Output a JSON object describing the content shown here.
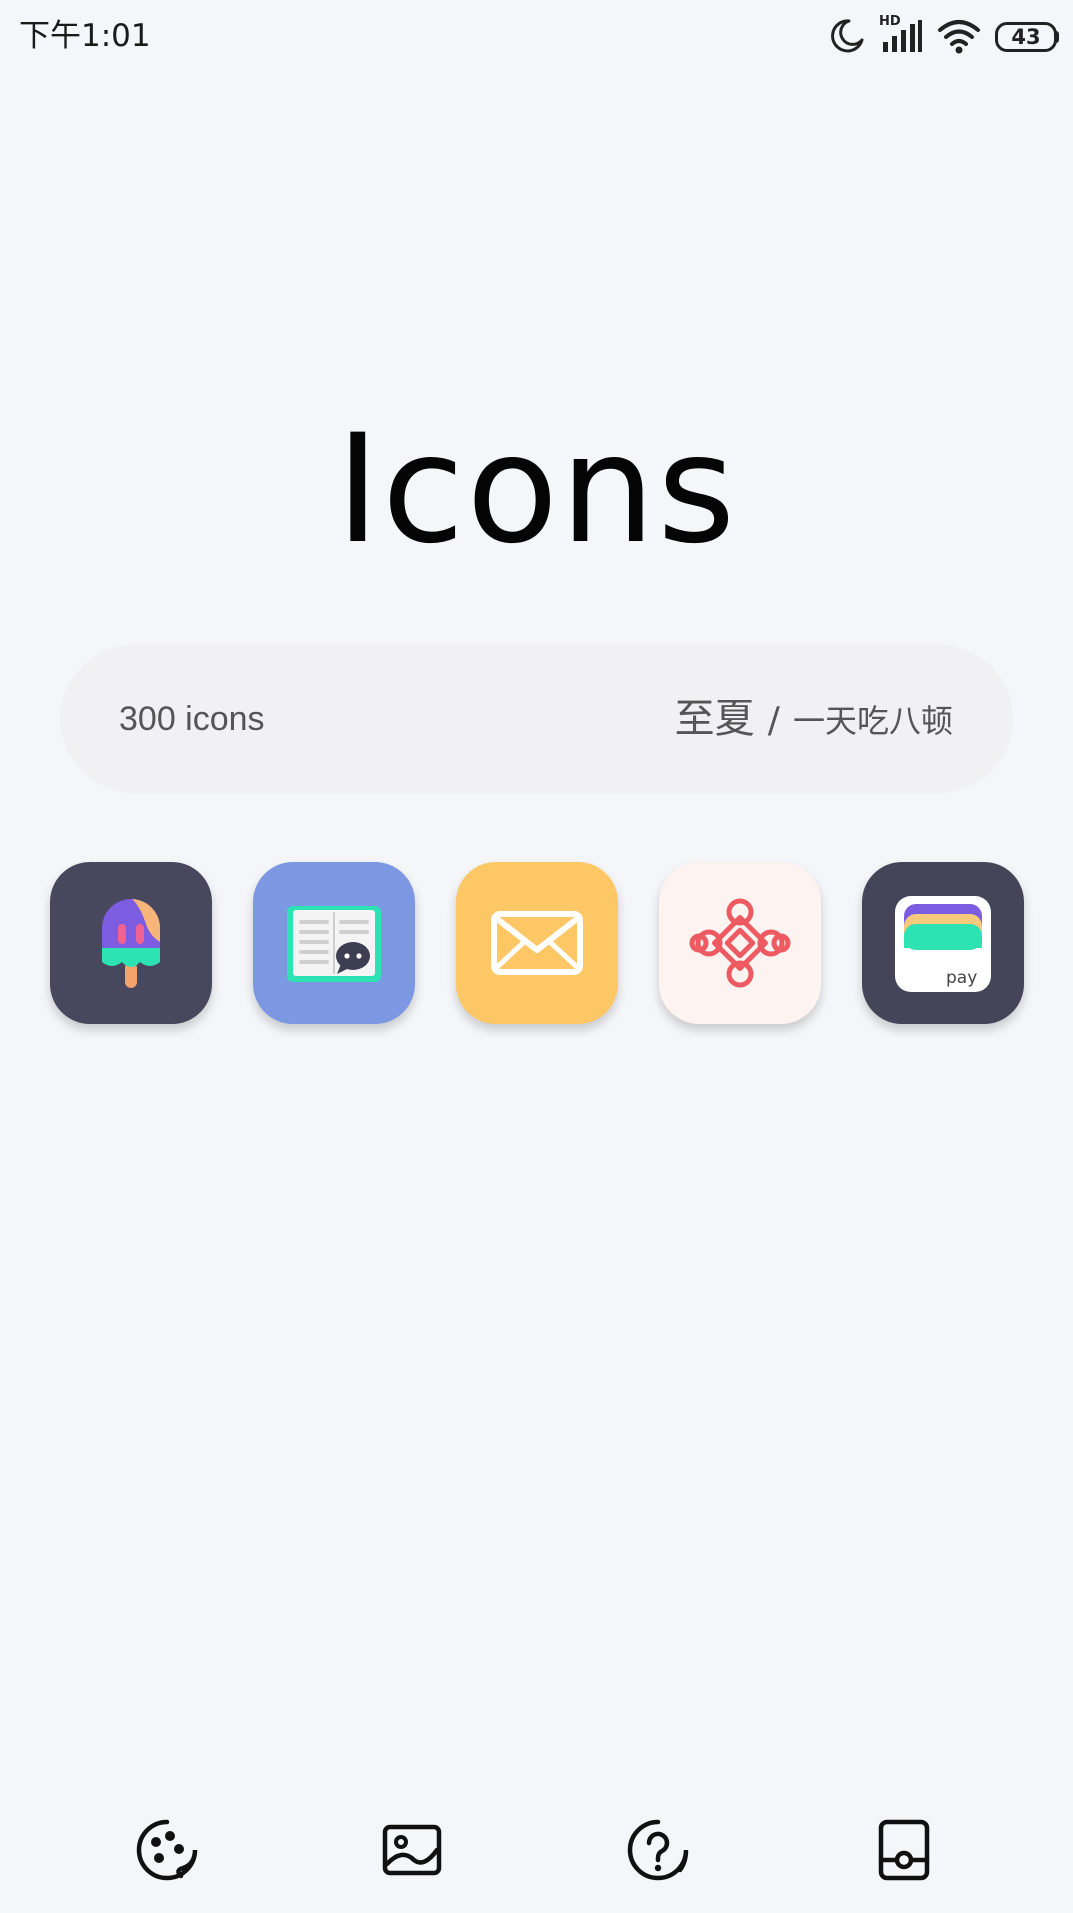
{
  "status_bar": {
    "time": "下午1:01",
    "network_label": "HD",
    "battery_level": "43",
    "icons": [
      "moon-icon",
      "signal-icon",
      "wifi-icon",
      "battery-icon"
    ]
  },
  "header": {
    "logo": "Icons"
  },
  "info": {
    "icon_count": "300 icons",
    "credit_primary": "至夏",
    "credit_separator": "/",
    "credit_secondary": "一天吃八顿"
  },
  "preview_icons": [
    {
      "name": "popsicle-app-icon",
      "background": "#47475e"
    },
    {
      "name": "book-chat-app-icon",
      "background": "#7c98e3"
    },
    {
      "name": "mail-app-icon",
      "background": "#fdc765"
    },
    {
      "name": "china-unicom-app-icon",
      "background": "#fdf4f2"
    },
    {
      "name": "wallet-pay-app-icon",
      "background": "#444559",
      "label": "pay"
    }
  ],
  "bottom_nav": [
    {
      "name": "icon-pack-tab",
      "icon": "palette-icon"
    },
    {
      "name": "wallpaper-tab",
      "icon": "image-icon"
    },
    {
      "name": "help-tab",
      "icon": "help-icon"
    },
    {
      "name": "apply-tab",
      "icon": "card-icon"
    }
  ]
}
